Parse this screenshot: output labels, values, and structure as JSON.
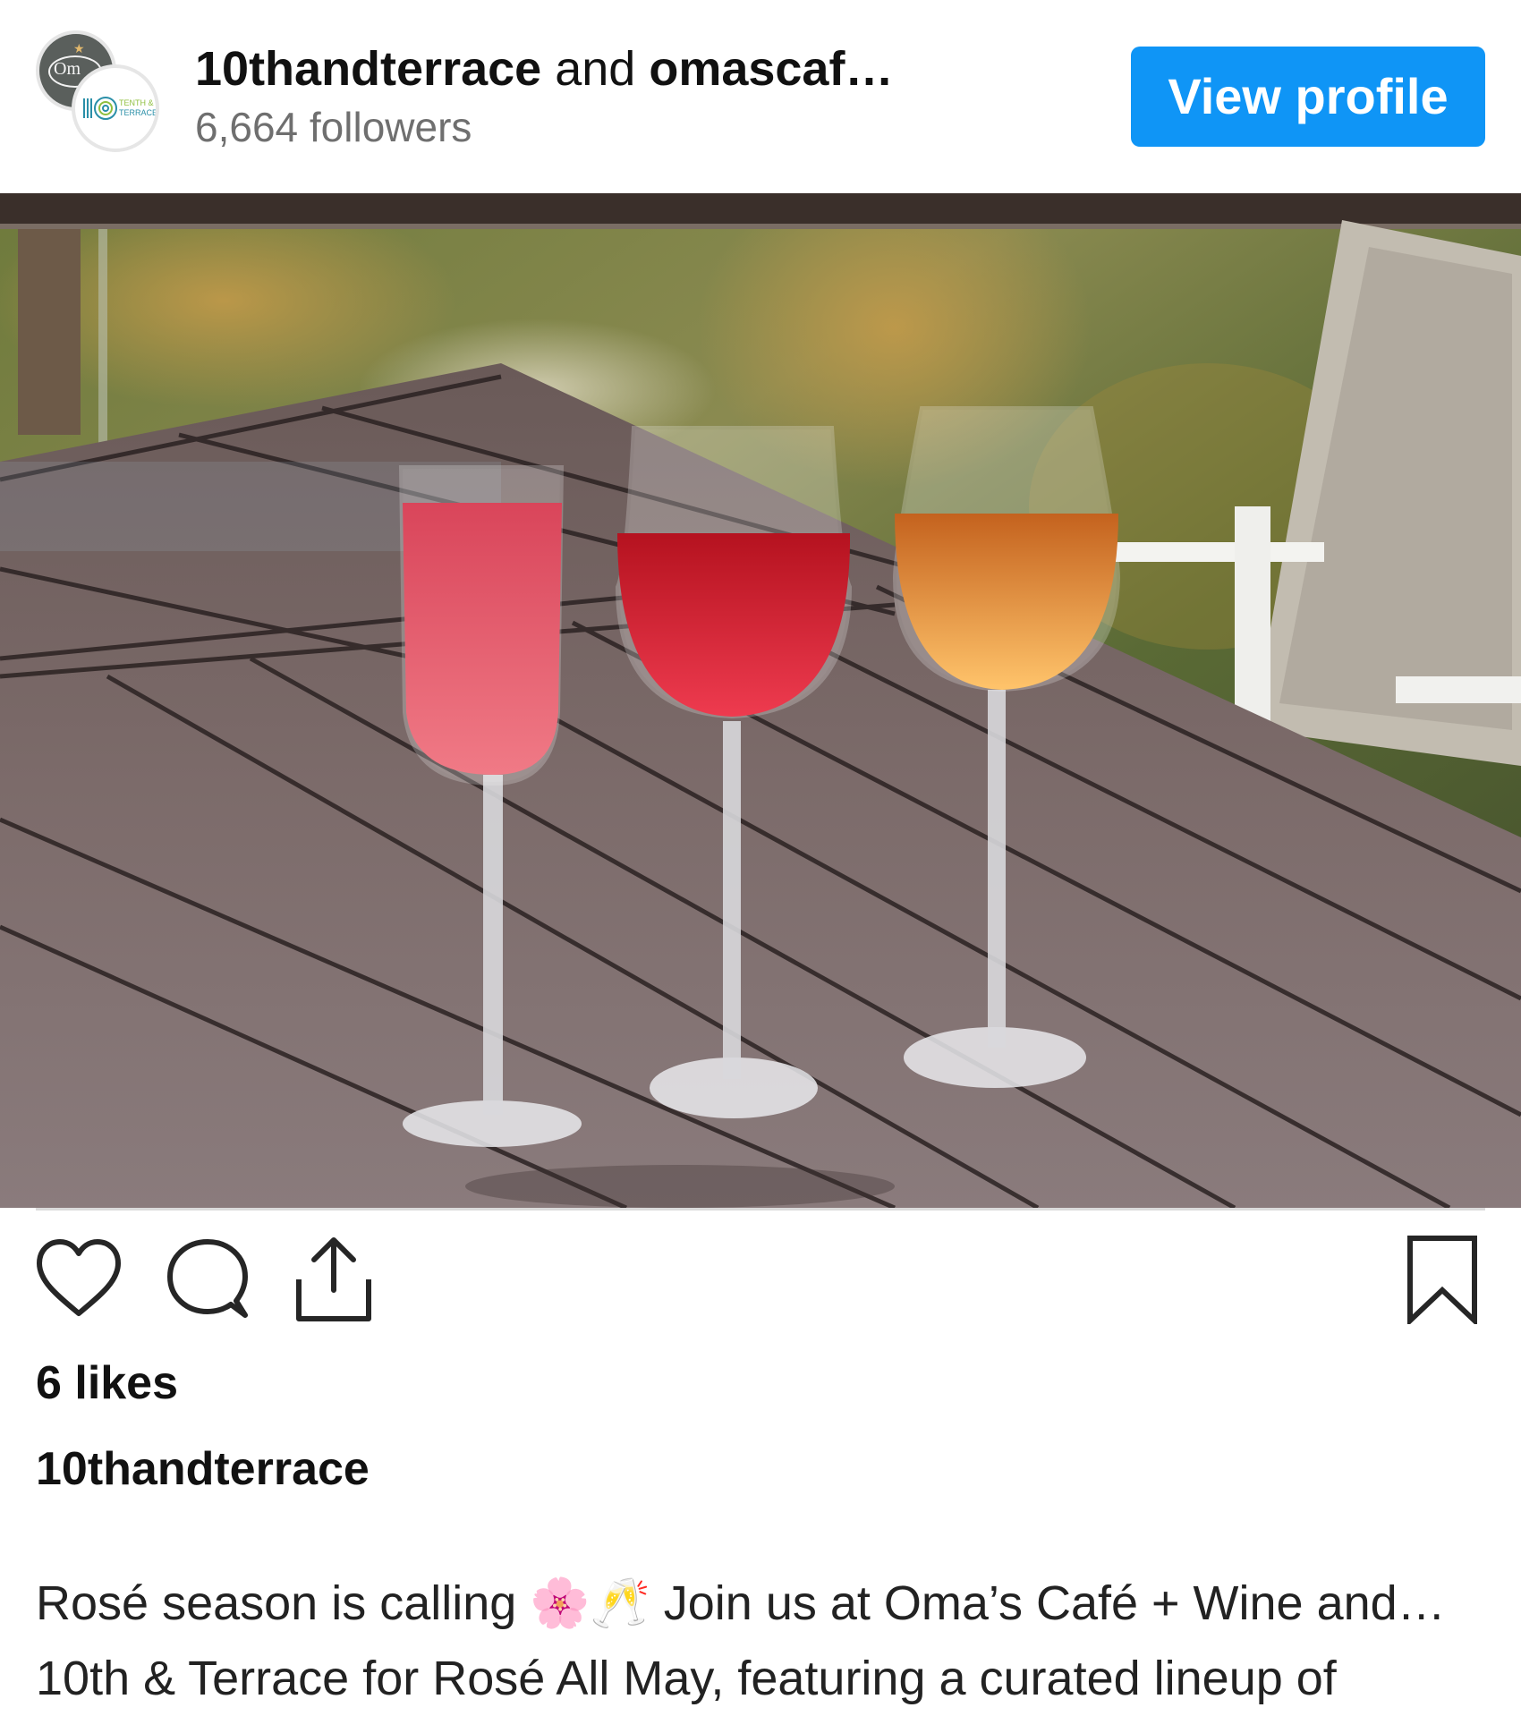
{
  "header": {
    "account_primary": "10thandterrace",
    "connector": "and",
    "account_secondary": "omascaf…",
    "followers": "6,664 followers",
    "view_profile_label": "View profile",
    "avatar_back_text": "Om",
    "avatar_front_text_line1": "TENTH &",
    "avatar_front_text_line2": "TERRACE"
  },
  "post": {
    "likes": "6 likes",
    "caption_username": "10thandterrace",
    "caption_line1": "Rosé season is calling 🌸🥂 Join us at Oma’s Café + Wine and…",
    "caption_line2": "10th & Terrace for Rosé All May, featuring a curated lineup of"
  },
  "colors": {
    "accent": "#0f95f6",
    "text_primary": "#111111",
    "text_secondary": "#6f6f6f",
    "divider": "#dbdbdb"
  },
  "icons": {
    "like": "heart-outline-icon",
    "comment": "speech-bubble-icon",
    "share": "share-upload-icon",
    "save": "bookmark-icon"
  }
}
